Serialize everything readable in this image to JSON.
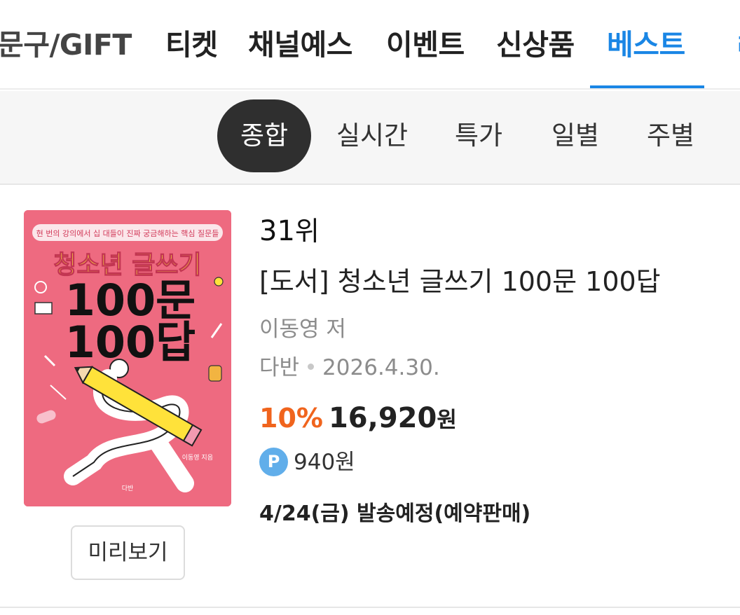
{
  "top_nav": {
    "tabs": [
      {
        "label": "문구/GIFT"
      },
      {
        "label": "티켓"
      },
      {
        "label": "채널예스"
      },
      {
        "label": "이벤트"
      },
      {
        "label": "신상품"
      },
      {
        "label": "베스트",
        "active": true
      },
      {
        "label": "ㄹ"
      }
    ],
    "active_color": "#1a86e5"
  },
  "sub_nav": {
    "chips": [
      {
        "label": "종합",
        "active": true
      },
      {
        "label": "실시간"
      },
      {
        "label": "특가"
      },
      {
        "label": "일별"
      },
      {
        "label": "주별"
      }
    ]
  },
  "product": {
    "rank_number": "31",
    "rank_suffix": "위",
    "title": "[도서] 청소년 글쓰기 100문 100답",
    "author": "이동영 저",
    "publisher": "다반",
    "pub_date": "2026.4.30.",
    "discount": "10%",
    "price": "16,920",
    "price_unit": "원",
    "point_icon": "P",
    "points": "940원",
    "shipping": "4/24(금) 발송예정(예약판매)",
    "preview_button": "미리보기",
    "cover": {
      "tagline": "현 번의 강의에서 십 대들이 진짜 궁금해하는 핵심 질문들",
      "title_main": "청소년 글쓰기",
      "title_line1": "100문",
      "title_line2": "100답",
      "cover_author": "이동영 지음",
      "publisher_mark": "다반",
      "bg_color": "#ee6a80",
      "accent_color": "#ffe23a"
    }
  },
  "colors": {
    "discount": "#f0641d",
    "point_badge": "#61aeea",
    "active_chip_bg": "#2f2f2f"
  }
}
